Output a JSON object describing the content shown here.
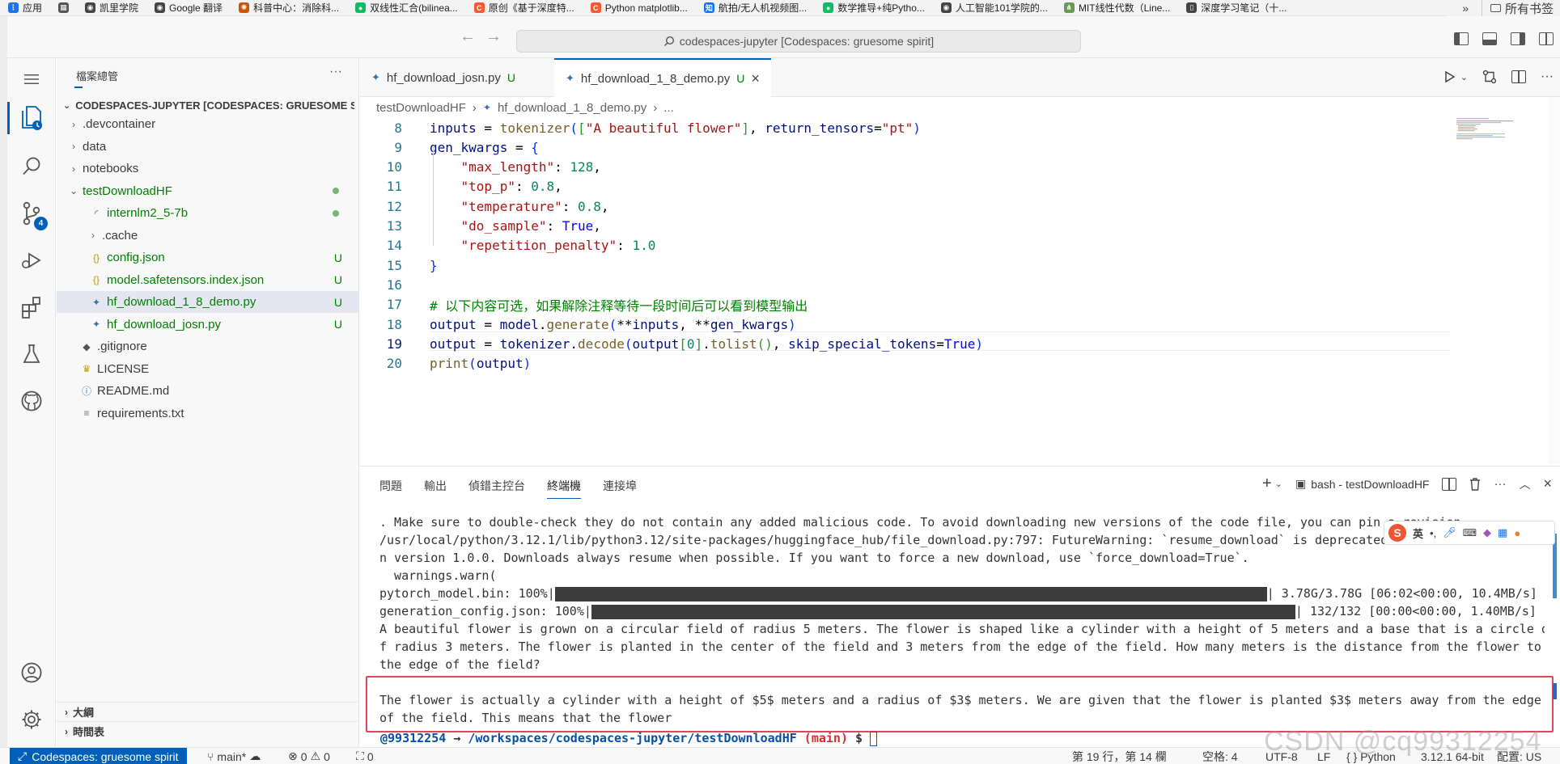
{
  "browser": {
    "bookmarks": [
      {
        "label": "应用",
        "icon": "apps-grid-icon",
        "color": "#1a73e8"
      },
      {
        "label": "",
        "icon": "grid-icon",
        "color": "#555555"
      },
      {
        "label": "凯里学院",
        "icon": "globe-icon",
        "color": "#444444"
      },
      {
        "label": "Google 翻译",
        "icon": "globe-icon",
        "color": "#444444"
      },
      {
        "label": "科普中心：消除科...",
        "icon": "science-icon",
        "color": "#d35400"
      },
      {
        "label": "双线性汇合(bilinea...",
        "icon": "wechat-icon",
        "color": "#07c160"
      },
      {
        "label": "原创《基于深度特...",
        "icon": "csdn-icon",
        "color": "#fc5531"
      },
      {
        "label": "Python matplotlib...",
        "icon": "csdn-icon",
        "color": "#fc5531"
      },
      {
        "label": "航拍/无人机视频图...",
        "icon": "zhihu-icon",
        "color": "#1772f6"
      },
      {
        "label": "数学推导+纯Pytho...",
        "icon": "wechat-icon",
        "color": "#07c160"
      },
      {
        "label": "人工智能101学院的...",
        "icon": "globe-icon",
        "color": "#444444"
      },
      {
        "label": "MIT线性代数（Line...",
        "icon": "graph-icon",
        "color": "#6a9955"
      },
      {
        "label": "深度学习笔记（十...",
        "icon": "book-icon",
        "color": "#444444"
      }
    ],
    "more_label": "»",
    "all_bookmarks_label": "所有书签"
  },
  "titlebar": {
    "command_center": "codespaces-jupyter [Codespaces: gruesome spirit]"
  },
  "activity_bar": {
    "scm_badge": "4"
  },
  "sidebar": {
    "title": "檔案總管",
    "more": "···",
    "root_label": "CODESPACES-JUPYTER [CODESPACES: GRUESOME S...",
    "items": [
      {
        "label": ".devcontainer",
        "kind": "folder",
        "expanded": false,
        "deco": ""
      },
      {
        "label": "data",
        "kind": "folder",
        "expanded": false,
        "deco": ""
      },
      {
        "label": "notebooks",
        "kind": "folder",
        "expanded": false,
        "deco": ""
      },
      {
        "label": "testDownloadHF",
        "kind": "folder",
        "expanded": true,
        "deco": "dot"
      },
      {
        "label": "internlm2_5-7b",
        "kind": "folder-loading",
        "expanded": false,
        "deco": "dot"
      },
      {
        "label": ".cache",
        "kind": "folder",
        "expanded": false,
        "deco": ""
      },
      {
        "label": "config.json",
        "kind": "json",
        "expanded": false,
        "deco": "U"
      },
      {
        "label": "model.safetensors.index.json",
        "kind": "json",
        "expanded": false,
        "deco": "U"
      },
      {
        "label": "hf_download_1_8_demo.py",
        "kind": "python",
        "expanded": false,
        "deco": "U"
      },
      {
        "label": "hf_download_josn.py",
        "kind": "python",
        "expanded": false,
        "deco": "U"
      },
      {
        "label": ".gitignore",
        "kind": "git",
        "expanded": false,
        "deco": ""
      },
      {
        "label": "LICENSE",
        "kind": "license",
        "expanded": false,
        "deco": ""
      },
      {
        "label": "README.md",
        "kind": "info",
        "expanded": false,
        "deco": ""
      },
      {
        "label": "requirements.txt",
        "kind": "text",
        "expanded": false,
        "deco": ""
      }
    ],
    "outline": "大綱",
    "timeline": "時間表"
  },
  "editor": {
    "tabs": [
      {
        "label": "hf_download_josn.py",
        "status": "U",
        "active": false
      },
      {
        "label": "hf_download_1_8_demo.py",
        "status": "U",
        "active": true
      }
    ],
    "close_icon": "×",
    "breadcrumb": [
      "testDownloadHF",
      "hf_download_1_8_demo.py",
      "..."
    ],
    "current_line": 19,
    "lines": [
      {
        "n": "8",
        "tokens": [
          [
            "inputs",
            "k-var"
          ],
          [
            " = ",
            "k-op"
          ],
          [
            "tokenizer",
            "k-fn"
          ],
          [
            "(",
            "k-br"
          ],
          [
            "[",
            "k-br2"
          ],
          [
            "\"A beautiful flower\"",
            "k-str"
          ],
          [
            "]",
            "k-br2"
          ],
          [
            ", ",
            "k-op"
          ],
          [
            "return_tensors",
            "k-var"
          ],
          [
            "=",
            "k-op"
          ],
          [
            "\"pt\"",
            "k-str"
          ],
          [
            ")",
            "k-br"
          ]
        ]
      },
      {
        "n": "9",
        "tokens": [
          [
            "gen_kwargs",
            "k-var"
          ],
          [
            " = ",
            "k-op"
          ],
          [
            "{",
            "k-br"
          ]
        ]
      },
      {
        "n": "10",
        "tokens": [
          [
            "    ",
            "k-op"
          ],
          [
            "\"max_length\"",
            "k-str"
          ],
          [
            ": ",
            "k-op"
          ],
          [
            "128",
            "k-num"
          ],
          [
            ",",
            "k-op"
          ]
        ]
      },
      {
        "n": "11",
        "tokens": [
          [
            "    ",
            "k-op"
          ],
          [
            "\"top_p\"",
            "k-str"
          ],
          [
            ": ",
            "k-op"
          ],
          [
            "0.8",
            "k-num"
          ],
          [
            ",",
            "k-op"
          ]
        ]
      },
      {
        "n": "12",
        "tokens": [
          [
            "    ",
            "k-op"
          ],
          [
            "\"temperature\"",
            "k-str"
          ],
          [
            ": ",
            "k-op"
          ],
          [
            "0.8",
            "k-num"
          ],
          [
            ",",
            "k-op"
          ]
        ]
      },
      {
        "n": "13",
        "tokens": [
          [
            "    ",
            "k-op"
          ],
          [
            "\"do_sample\"",
            "k-str"
          ],
          [
            ": ",
            "k-op"
          ],
          [
            "True",
            "k-kw"
          ],
          [
            ",",
            "k-op"
          ]
        ]
      },
      {
        "n": "14",
        "tokens": [
          [
            "    ",
            "k-op"
          ],
          [
            "\"repetition_penalty\"",
            "k-str"
          ],
          [
            ": ",
            "k-op"
          ],
          [
            "1.0",
            "k-num"
          ]
        ]
      },
      {
        "n": "15",
        "tokens": [
          [
            "}",
            "k-br"
          ]
        ]
      },
      {
        "n": "16",
        "tokens": []
      },
      {
        "n": "17",
        "tokens": [
          [
            "# 以下内容可选，如果解除注释等待一段时间后可以看到模型输出",
            "k-com"
          ]
        ]
      },
      {
        "n": "18",
        "tokens": [
          [
            "output",
            "k-var"
          ],
          [
            " = ",
            "k-op"
          ],
          [
            "model",
            "k-var"
          ],
          [
            ".",
            "k-op"
          ],
          [
            "generate",
            "k-fn"
          ],
          [
            "(",
            "k-br"
          ],
          [
            "**",
            "k-op"
          ],
          [
            "inputs",
            "k-var"
          ],
          [
            ", ",
            "k-op"
          ],
          [
            "**",
            "k-op"
          ],
          [
            "gen_kwargs",
            "k-var"
          ],
          [
            ")",
            "k-br"
          ]
        ]
      },
      {
        "n": "19",
        "tokens": [
          [
            "output",
            "k-var"
          ],
          [
            " = ",
            "k-op"
          ],
          [
            "tokenizer",
            "k-var"
          ],
          [
            ".",
            "k-op"
          ],
          [
            "decode",
            "k-fn"
          ],
          [
            "(",
            "k-br"
          ],
          [
            "output",
            "k-var"
          ],
          [
            "[",
            "k-br2"
          ],
          [
            "0",
            "k-num"
          ],
          [
            "]",
            "k-br2"
          ],
          [
            ".",
            "k-op"
          ],
          [
            "tolist",
            "k-fn"
          ],
          [
            "()",
            "k-br2"
          ],
          [
            ", ",
            "k-op"
          ],
          [
            "skip_special_tokens",
            "k-var"
          ],
          [
            "=",
            "k-op"
          ],
          [
            "True",
            "k-kw"
          ],
          [
            ")",
            "k-br"
          ]
        ]
      },
      {
        "n": "20",
        "tokens": [
          [
            "print",
            "k-fn"
          ],
          [
            "(",
            "k-br"
          ],
          [
            "output",
            "k-var"
          ],
          [
            ")",
            "k-br"
          ]
        ]
      }
    ]
  },
  "panel": {
    "tabs": [
      {
        "label": "問題",
        "active": false
      },
      {
        "label": "輸出",
        "active": false
      },
      {
        "label": "偵錯主控台",
        "active": false
      },
      {
        "label": "終端機",
        "active": true
      },
      {
        "label": "連接埠",
        "active": false
      }
    ],
    "terminal_name": "bash - testDownloadHF",
    "terminal_lines": [
      ". Make sure to double-check they do not contain any added malicious code. To avoid downloading new versions of the code file, you can pin a revision.",
      "/usr/local/python/3.12.1/lib/python3.12/site-packages/huggingface_hub/file_download.py:797: FutureWarning: `resume_download` is deprecated and will be removed i",
      "n version 1.0.0. Downloads always resume when possible. If you want to force a new download, use `force_download=True`.",
      "  warnings.warn("
    ],
    "progress": [
      {
        "label": "pytorch_model.bin: 100%|",
        "fraction": 1.0,
        "stats": "| 3.78G/3.78G [06:02<00:00, 10.4MB/s]"
      },
      {
        "label": "generation_config.json: 100%|",
        "fraction": 1.0,
        "stats": "| 132/132 [00:00<00:00, 1.40MB/s]"
      }
    ],
    "answer_lines": [
      "A beautiful flower is grown on a circular field of radius 5 meters. The flower is shaped like a cylinder with a height of 5 meters and a base that is a circle o",
      "f radius 3 meters. The flower is planted in the center of the field and 3 meters from the edge of the field. How many meters is the distance from the flower to",
      "the edge of the field?",
      "",
      "The flower is actually a cylinder with a height of $5$ meters and a radius of $3$ meters. We are given that the flower is planted $3$ meters away from the edge",
      "of the field. This means that the flower"
    ],
    "prompt_user": "@99312254",
    "prompt_arrow": "→",
    "prompt_path": "/workspaces/codespaces-jupyter/testDownloadHF",
    "prompt_branch": "(main)",
    "prompt_dollar": "$"
  },
  "ime": {
    "logo": "S",
    "mode": "英",
    "punct": "•,"
  },
  "statusbar": {
    "remote": "Codespaces: gruesome spirit",
    "branch": "main*",
    "errors": "0",
    "warnings": "0",
    "ports": "0",
    "position": "第 19 行，第 14 欄",
    "spaces": "空格: 4",
    "encoding": "UTF-8",
    "eol": "LF",
    "language": "Python",
    "interpreter": "3.12.1 64-bit",
    "config": "配置: US"
  },
  "watermark": "CSDN @cq99312254"
}
